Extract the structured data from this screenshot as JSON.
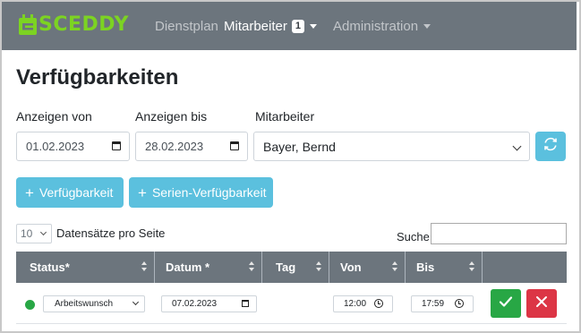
{
  "navbar": {
    "brand": "SCEDDY",
    "items": [
      {
        "label": "Dienstplan"
      },
      {
        "label": "Mitarbeiter",
        "badge": "1"
      },
      {
        "label": "Administration"
      }
    ]
  },
  "page": {
    "title": "Verfügbarkeiten"
  },
  "filters": {
    "from_label": "Anzeigen von",
    "from_value": "01.02.2023",
    "to_label": "Anzeigen bis",
    "to_value": "28.02.2023",
    "employee_label": "Mitarbeiter",
    "employee_value": "Bayer, Bernd"
  },
  "actions": {
    "add_label": "Verfügbarkeit",
    "add_series_label": "Serien-Verfügbarkeit"
  },
  "table_controls": {
    "page_length": "10",
    "page_length_text": "Datensätze pro Seite",
    "search_label": "Suche:"
  },
  "table": {
    "columns": [
      "Status*",
      "Datum *",
      "Tag",
      "Von",
      "Bis"
    ],
    "rows": [
      {
        "type": "Arbeitswunsch",
        "date": "07.02.2023",
        "from": "12:00",
        "to": "17:59"
      }
    ]
  },
  "colors": {
    "navbar": "#6c757d",
    "brand": "#7cd322",
    "info": "#5bc0de",
    "success": "#28a745",
    "danger": "#dc3545"
  }
}
